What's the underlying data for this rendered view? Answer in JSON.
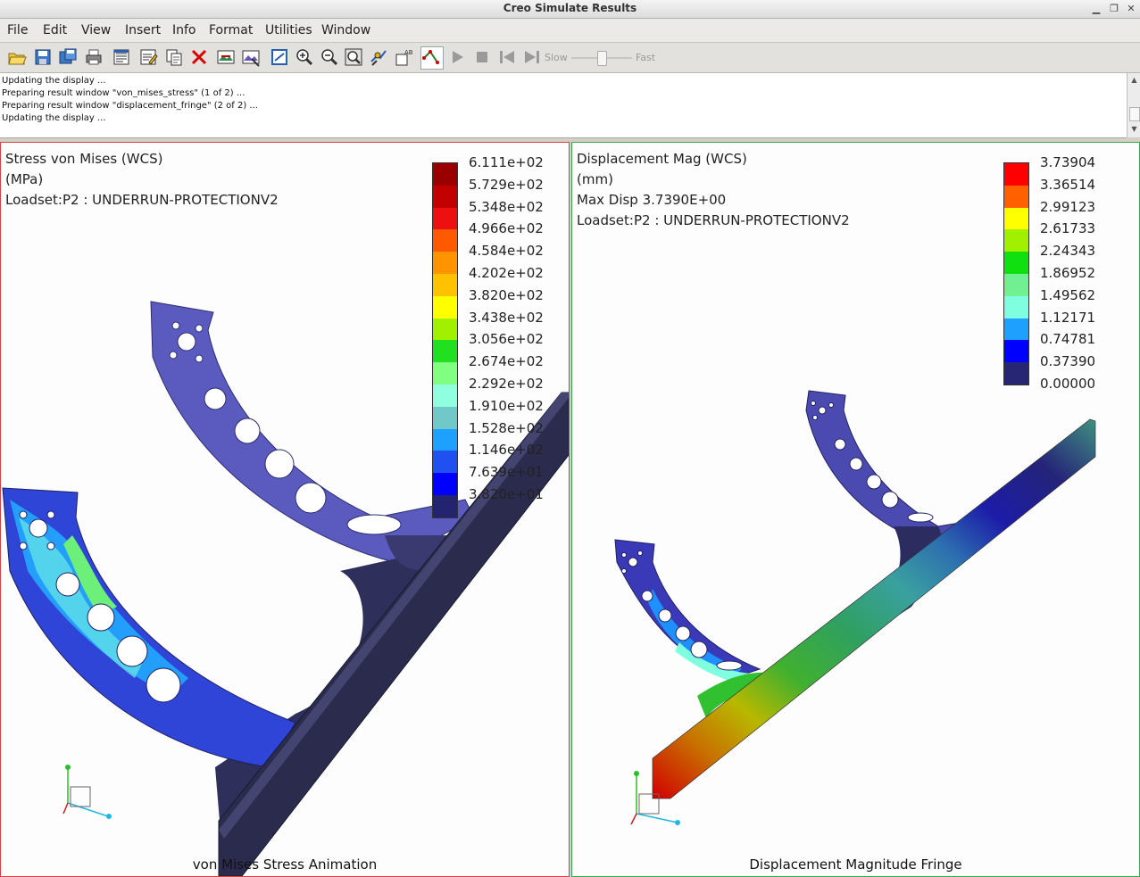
{
  "window": {
    "title": "Creo Simulate Results"
  },
  "menu": [
    "File",
    "Edit",
    "View",
    "Insert",
    "Info",
    "Format",
    "Utilities",
    "Window"
  ],
  "toolbar": {
    "buttons": [
      "open-icon",
      "save-icon",
      "save-as-icon",
      "print-icon",
      "edit-window-icon",
      "edit-definition-icon",
      "copy-icon",
      "delete-icon",
      "show-icon",
      "hide-icon",
      "display-options-icon",
      "zoom-in-icon",
      "zoom-out-icon",
      "refit-icon",
      "orient-icon",
      "label-icon",
      "query-icon",
      "play-icon",
      "stop-icon",
      "first-frame-icon",
      "last-frame-icon"
    ],
    "slow_label": "Slow",
    "fast_label": "Fast",
    "speed_fraction": 0.45
  },
  "log": [
    "Updating the display ...",
    "Preparing result window \"von_mises_stress\" (1 of 2) ...",
    "Preparing result window \"displacement_fringe\" (2 of 2) ...",
    "Updating the display ..."
  ],
  "left_panel": {
    "header": [
      "Stress von Mises (WCS)",
      "(MPa)",
      "Loadset:P2 :  UNDERRUN-PROTECTIONV2"
    ],
    "legend_values": [
      "6.111e+02",
      "5.729e+02",
      "5.348e+02",
      "4.966e+02",
      "4.584e+02",
      "4.202e+02",
      "3.820e+02",
      "3.438e+02",
      "3.056e+02",
      "2.674e+02",
      "2.292e+02",
      "1.910e+02",
      "1.528e+02",
      "1.146e+02",
      "7.639e+01",
      "3.820e+01"
    ],
    "legend_colors": [
      "#9b0000",
      "#c30000",
      "#ee1010",
      "#ff5a00",
      "#ff9400",
      "#ffc200",
      "#ffff00",
      "#a0f000",
      "#20e020",
      "#80ff80",
      "#90ffe0",
      "#70c8c8",
      "#1ea0ff",
      "#2050f0",
      "#0000ff",
      "#232370"
    ],
    "caption": "von Mises Stress Animation"
  },
  "right_panel": {
    "header": [
      "Displacement Mag (WCS)",
      "(mm)",
      "Max Disp  3.7390E+00",
      "Loadset:P2 :  UNDERRUN-PROTECTIONV2"
    ],
    "legend_values": [
      "3.73904",
      "3.36514",
      "2.99123",
      "2.61733",
      "2.24343",
      "1.86952",
      "1.49562",
      "1.12171",
      "0.74781",
      "0.37390",
      "0.00000"
    ],
    "legend_colors": [
      "#ff0000",
      "#ff6000",
      "#ffff00",
      "#a0f000",
      "#10e010",
      "#70f090",
      "#80ffe0",
      "#1ea0ff",
      "#0000ff",
      "#262675"
    ],
    "caption": "Displacement Magnitude Fringe"
  }
}
